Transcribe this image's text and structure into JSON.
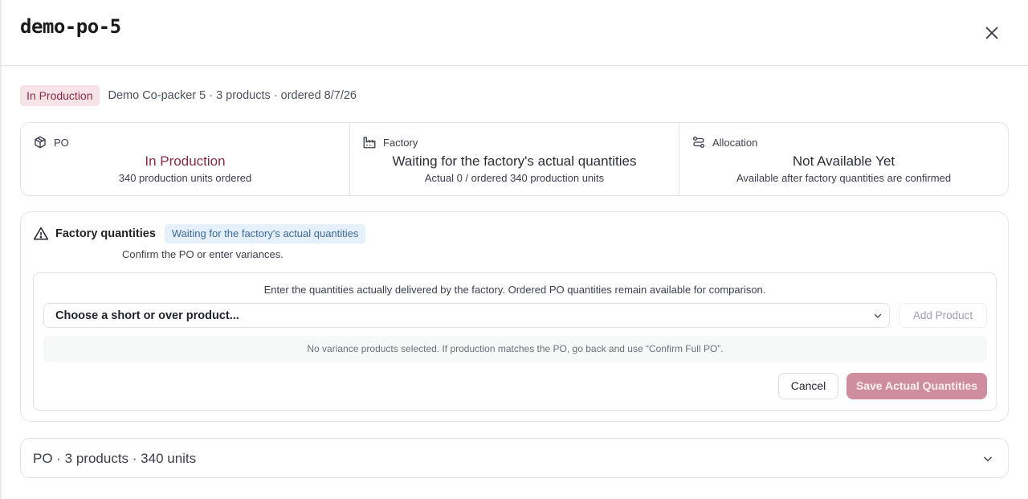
{
  "modal": {
    "title": "demo-po-5"
  },
  "status": {
    "badge": "In Production",
    "meta": "Demo Co-packer 5 · 3 products · ordered 8/7/26",
    "badge_bg": "#f6e3e8",
    "badge_color": "#8b2a45"
  },
  "cards": [
    {
      "icon": "package-icon",
      "label": "PO",
      "value": "In Production",
      "sub": "340 production units ordered"
    },
    {
      "icon": "factory-icon",
      "label": "Factory",
      "value": "Waiting for the factory's actual quantities",
      "sub": "Actual 0 / ordered 340 production units"
    },
    {
      "icon": "allocation-icon",
      "label": "Allocation",
      "value": "Not Available Yet",
      "sub": "Available after factory quantities are confirmed"
    }
  ],
  "factory_quantities": {
    "title": "Factory quantities",
    "chip": "Waiting for the factory's actual quantities",
    "description": "Confirm the PO or enter variances.",
    "note": "Enter the quantities actually delivered by the factory. Ordered PO quantities remain available for comparison.",
    "select_value": "Choose a short or over product...",
    "add_product": "Add Product",
    "empty_message": "No variance products selected. If production matches the PO, go back and use “Confirm Full PO”.",
    "cancel": "Cancel",
    "save": "Save Actual Quantities"
  },
  "summary": {
    "text": "PO · 3 products · 340 units"
  }
}
